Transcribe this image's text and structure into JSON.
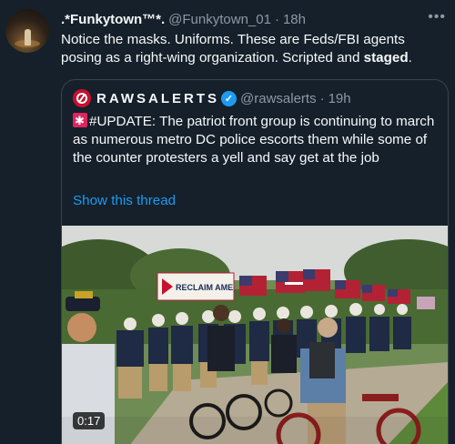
{
  "tweet": {
    "display_name": ".*Funkytown™*.",
    "handle": "@Funkytown_01",
    "separator": "·",
    "time": "18h",
    "text_main": "Notice the masks. Uniforms. These are Feds/FBI agents posing as a right-wing organization. Scripted and ",
    "text_bold": "staged",
    "text_end": "."
  },
  "quote": {
    "name": "RAWSALERTS",
    "handle": "@rawsalerts",
    "separator": "·",
    "time": "19h",
    "text": "#UPDATE: The patriot front group is continuing to march as numerous metro DC police escorts them while some of the counter protesters a yell and say get at the job",
    "show_thread": "Show this thread",
    "video_duration": "0:17",
    "banner_text": "RECLAIM AME"
  },
  "icons": {
    "more": "more-icon",
    "verified": "verified-icon",
    "siren": "siren-icon"
  },
  "colors": {
    "background": "#15202b",
    "link": "#1d9bf0",
    "muted": "#8b98a5",
    "verified": "#1d9bf0"
  }
}
